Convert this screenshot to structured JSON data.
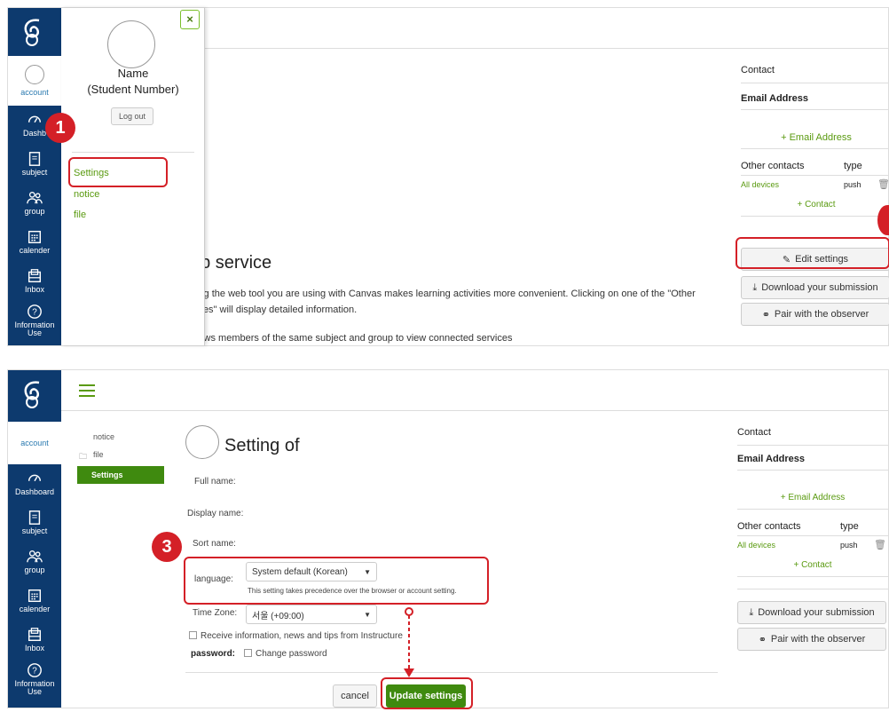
{
  "nav": {
    "account": "account",
    "dashboard": "Dashboard",
    "dashboard_cut": "Dashb",
    "subject": "subject",
    "group": "group",
    "calender": "calender",
    "inbox": "Inbox",
    "information": "Information Use"
  },
  "tray": {
    "close": "×",
    "name": "Name",
    "student_number": "(Student Number)",
    "logout": "Log out",
    "links": [
      "Settings",
      "notice",
      "file"
    ]
  },
  "web_service": {
    "title": "eb service",
    "desc1": "ing the web tool you are using with Canvas makes learning activities more convenient. Clicking on one of the \"Other",
    "desc2": "ices\" will display detailed information.",
    "desc3": "lows members of the same subject and group to view connected services"
  },
  "contact": {
    "heading": "Contact",
    "email_heading": "Email Address",
    "add_email": "+ Email Address",
    "other_contacts": "Other contacts",
    "type": "type",
    "device": "All devices",
    "device_type": "push",
    "add_contact": "+ Contact"
  },
  "buttons": {
    "edit_settings": "Edit settings",
    "download": "Download your submission",
    "pair": "Pair with the observer"
  },
  "badges": [
    "1",
    "3"
  ],
  "settings_page": {
    "subnav": [
      "notice",
      "file",
      "Settings"
    ],
    "title": "Setting of",
    "full_name": "Full name:",
    "display_name": "Display name:",
    "sort_name": "Sort name:",
    "language_label": "language:",
    "language_value": "System default (Korean)",
    "language_note": "This setting takes precedence over the browser or account setting.",
    "timezone_label": "Time Zone:",
    "timezone_value": "서울 (+09:00)",
    "receive_info": "Receive information, news and tips from Instructure",
    "password_label": "password:",
    "change_password": "Change password",
    "cancel": "cancel",
    "update": "Update settings"
  },
  "colors": {
    "nav_bg": "#0d3a6e",
    "accent_green": "#5a9a10",
    "button_green": "#3f8a0f",
    "highlight_red": "#d42027"
  }
}
